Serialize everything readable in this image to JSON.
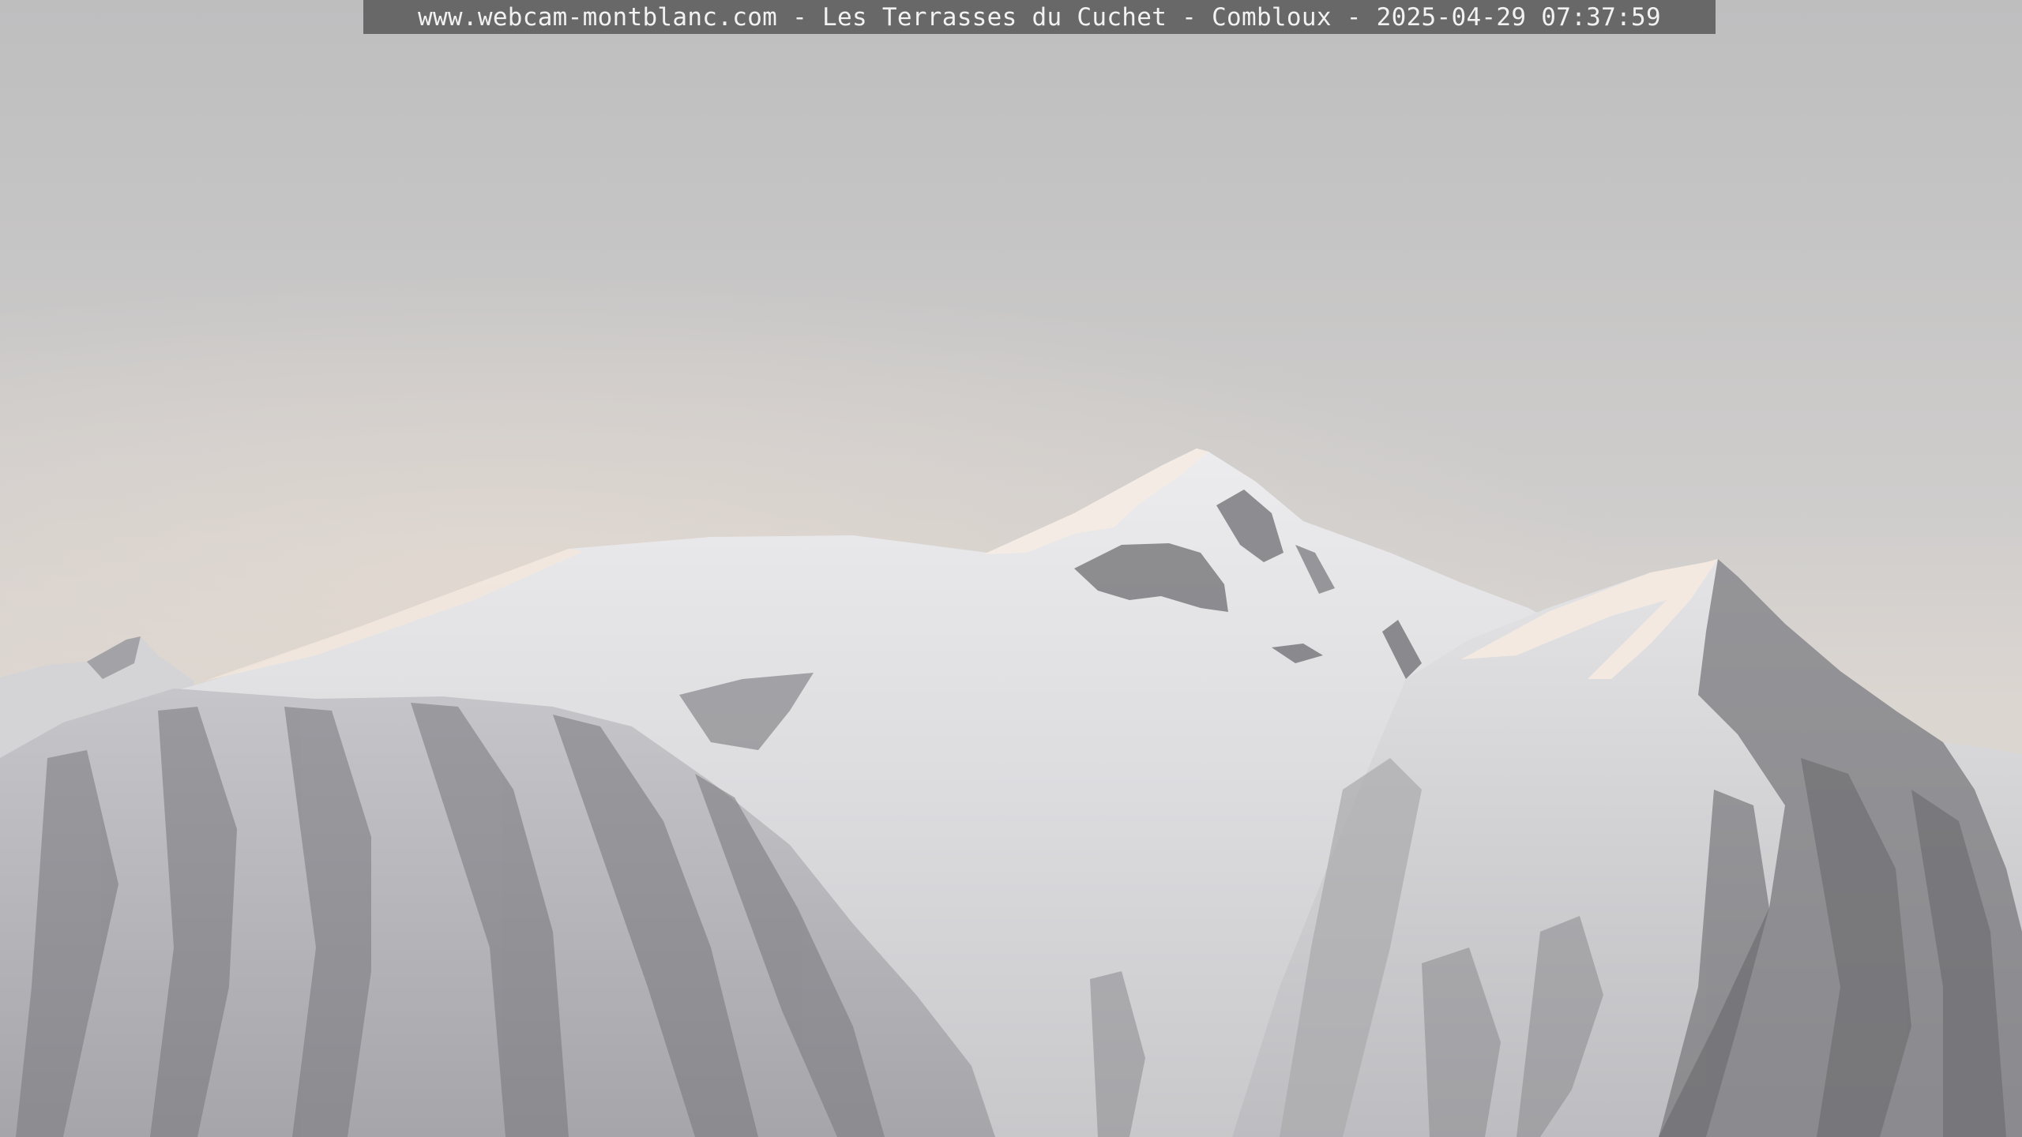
{
  "overlay": {
    "caption": "www.webcam-montblanc.com - Les Terrasses du Cuchet - Combloux - 2025-04-29 07:37:59"
  },
  "scene": {
    "icon": "mountain-landscape-icon",
    "colors": {
      "sky_top": "#bdbdbf",
      "sky_horizon": "#dcd6d1",
      "snow": "#e6e6e8",
      "snow_shadow": "#cfcfd2",
      "rock": "#6f6f73",
      "sunlit_ridge": "#f2e4da"
    }
  }
}
